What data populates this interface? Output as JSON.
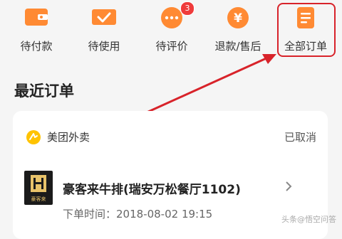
{
  "shortcuts": [
    {
      "label": "待付款",
      "icon": "wallet-icon"
    },
    {
      "label": "待使用",
      "icon": "ticket-check-icon"
    },
    {
      "label": "待评价",
      "icon": "comment-icon",
      "badge": "3"
    },
    {
      "label": "退款/售后",
      "icon": "yen-refund-icon"
    },
    {
      "label": "全部订单",
      "icon": "order-list-icon"
    }
  ],
  "section": {
    "title": "最近订单"
  },
  "order": {
    "brand": "美团外卖",
    "status": "已取消",
    "shop_name": "豪客来牛排(瑞安万松餐厅1102)",
    "time": "下单时间：2018-08-02 19:15",
    "logo_text": "豪客来"
  },
  "watermark": "头条@悟空问答",
  "colors": {
    "accent": "#ff7a2e",
    "highlight": "#d8232a",
    "badge": "#ef3b3b"
  }
}
